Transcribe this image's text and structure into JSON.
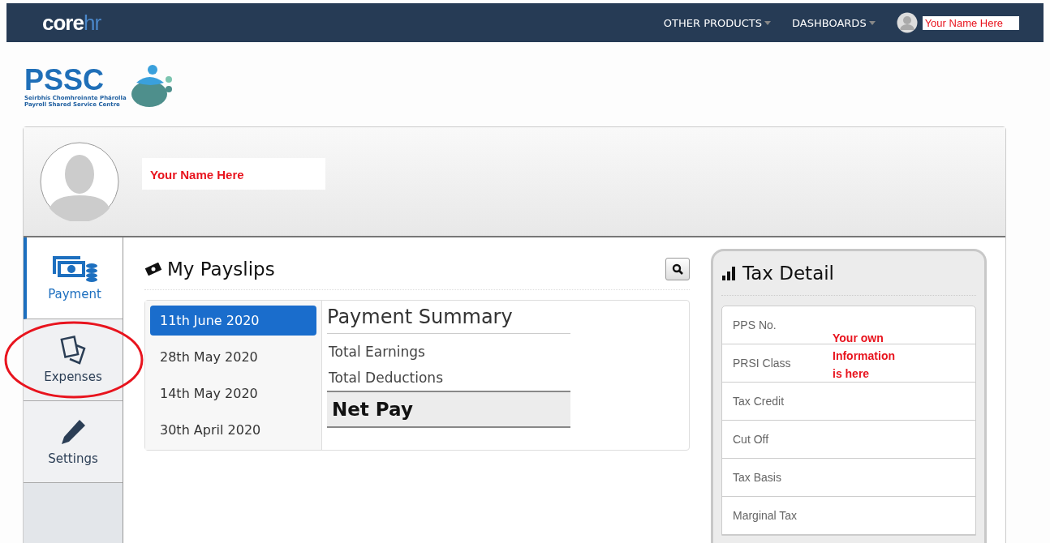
{
  "navbar": {
    "brand": {
      "part_1": "core",
      "part_2": "hr"
    },
    "menus": [
      "OTHER PRODUCTS",
      "DASHBOARDS"
    ],
    "user_name": "Your Name Here"
  },
  "logo": {
    "acronym": "PSSC",
    "tagline": [
      "Seirbhís Chomhroinnte Phárolla",
      "Payroll Shared Service Centre"
    ]
  },
  "profile": {
    "name": "Your Name Here"
  },
  "sidebar": {
    "items": [
      {
        "label": "Payment",
        "kind": "payment",
        "selected": true,
        "highlighted": false
      },
      {
        "label": "Expenses",
        "kind": "expenses",
        "selected": false,
        "highlighted": true
      },
      {
        "label": "Settings",
        "kind": "settings",
        "selected": false,
        "highlighted": false
      }
    ]
  },
  "payslips": {
    "title": "My Payslips",
    "dates": [
      {
        "label": "11th June 2020",
        "selected": true
      },
      {
        "label": "28th May 2020",
        "selected": false
      },
      {
        "label": "14th May 2020",
        "selected": false
      },
      {
        "label": "30th April 2020",
        "selected": false
      }
    ],
    "summary": {
      "title": "Payment Summary",
      "rows": [
        {
          "label": "Total Earnings",
          "kind": "line"
        },
        {
          "label": "Total Deductions",
          "kind": "line"
        },
        {
          "label": "Net Pay",
          "kind": "total"
        }
      ]
    }
  },
  "tax_detail": {
    "title": "Tax Detail",
    "rows": [
      "PPS No.",
      "PRSI Class",
      "Tax Credit",
      "Cut Off",
      "Tax Basis",
      "Marginal Tax"
    ],
    "annotation": [
      "Your own",
      "Information",
      "is here"
    ]
  }
}
